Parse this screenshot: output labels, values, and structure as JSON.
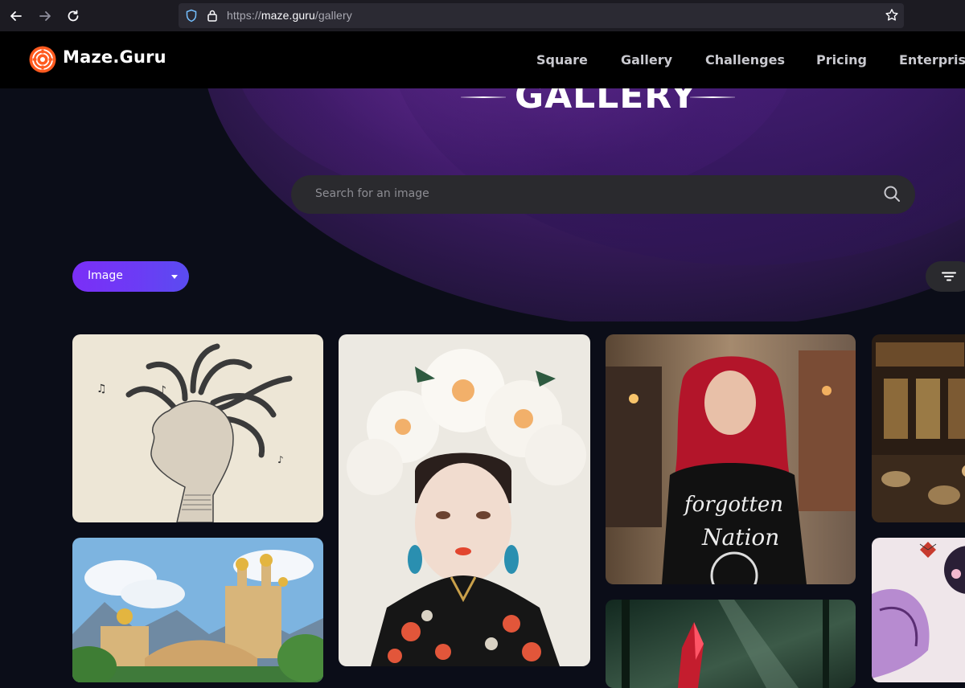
{
  "browser": {
    "url_prefix": "https://",
    "url_host": "maze.guru",
    "url_path": "/gallery"
  },
  "header": {
    "brand": "Maze.Guru",
    "nav": [
      "Square",
      "Gallery",
      "Challenges",
      "Pricing",
      "Enterprise"
    ]
  },
  "hero": {
    "title": "GALLERY",
    "search_placeholder": "Search for an image"
  },
  "filters": {
    "type_selected": "Image"
  },
  "colors": {
    "accent": "#7b2ff7",
    "background": "#0b0d18",
    "logo": "#ff5a1f"
  },
  "icons": [
    "back-icon",
    "forward-icon",
    "reload-icon",
    "shield-icon",
    "lock-icon",
    "star-icon",
    "search-icon",
    "sort-icon",
    "caret-down-icon",
    "logo-icon"
  ]
}
